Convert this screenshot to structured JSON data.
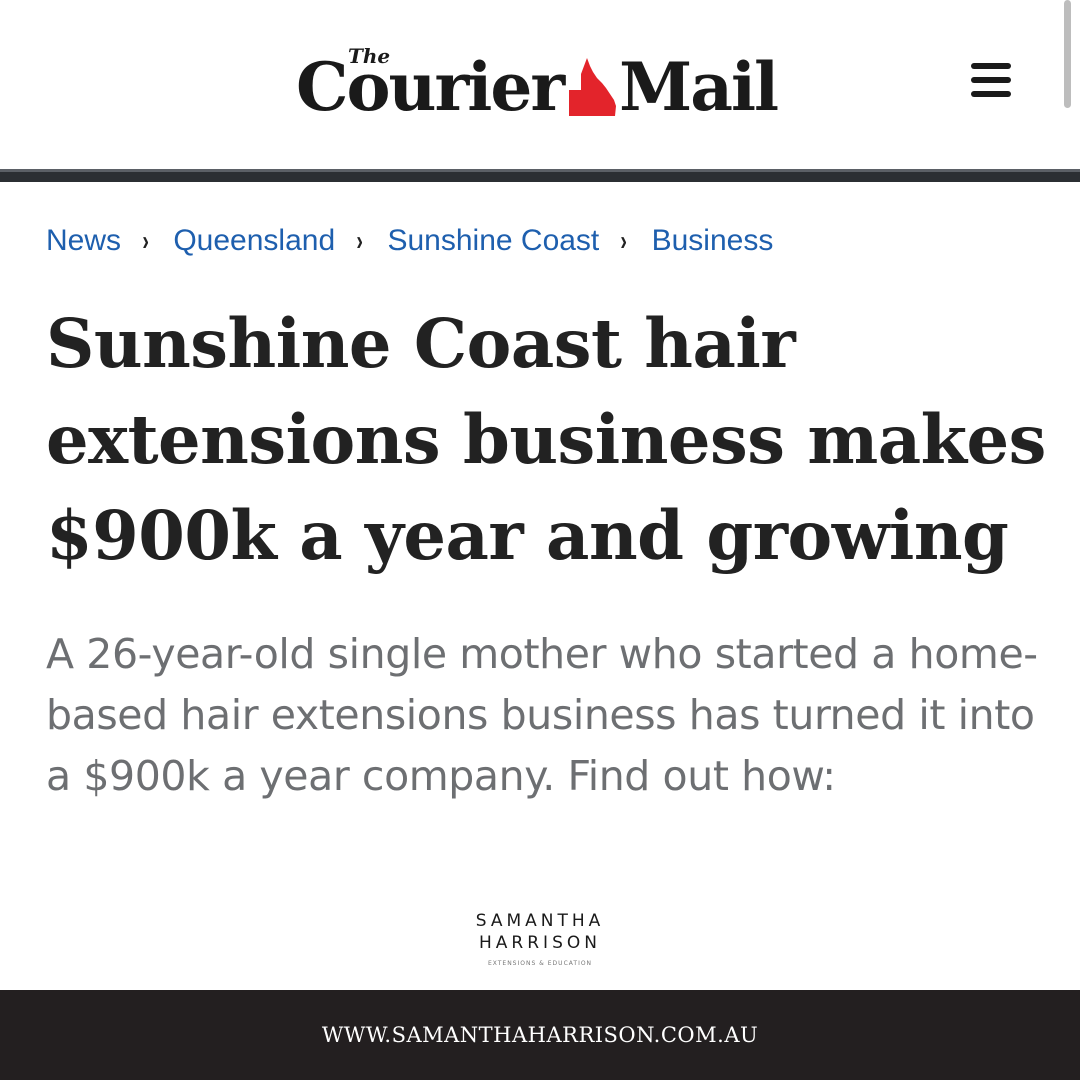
{
  "masthead": {
    "logo_the": "The",
    "logo_word_1": "Courier",
    "logo_word_2": "Mail",
    "map_icon": "queensland-map-icon",
    "map_color": "#e3242b",
    "menu_icon": "hamburger-menu-icon"
  },
  "breadcrumb": {
    "items": [
      "News",
      "Queensland",
      "Sunshine Coast",
      "Business"
    ],
    "separator": "›",
    "link_color": "#1e5fae"
  },
  "article": {
    "headline": "Sunshine Coast hair extensions business makes $900k a year and growing",
    "standfirst": "A 26-year-old single mother who started a home-based hair extensions business has turned it into a $900k a year company. Find out how:"
  },
  "brand": {
    "line1": "SAMANTHA",
    "line2": "HARRISON",
    "tagline": "EXTENSIONS & EDUCATION"
  },
  "footer": {
    "url": "WWW.SAMANTHAHARRISON.COM.AU",
    "background": "#231f20"
  }
}
